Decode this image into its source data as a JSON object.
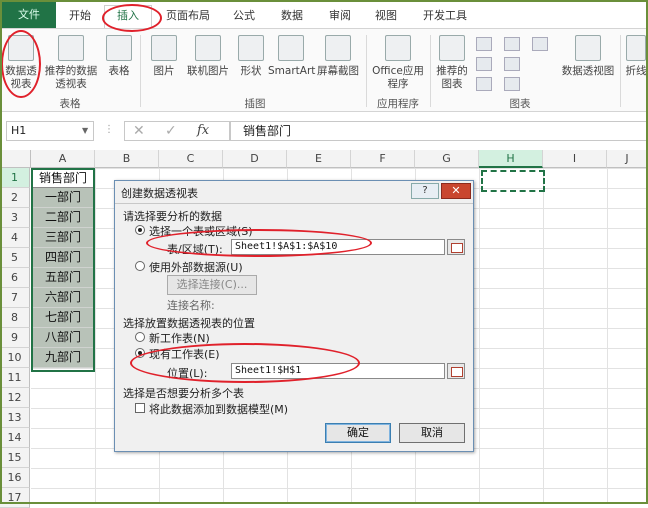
{
  "ribbon_tabs": {
    "file": "文件",
    "home": "开始",
    "insert": "插入",
    "page_layout": "页面布局",
    "formulas": "公式",
    "data": "数据",
    "review": "审阅",
    "view": "视图",
    "developer": "开发工具"
  },
  "ribbon": {
    "pivot_table": "数据透视表",
    "recommended_pivot": "推荐的数据透视表",
    "table": "表格",
    "group_tables": "表格",
    "pictures": "图片",
    "online_pictures": "联机图片",
    "shapes": "形状",
    "smartart": "SmartArt",
    "screenshot": "屏幕截图",
    "group_illustrations": "插图",
    "office_apps": "Office应用程序",
    "group_apps": "应用程序",
    "recommended_charts": "推荐的图表",
    "pivot_chart": "数据透视图",
    "group_charts": "图表",
    "sparkline": "折线"
  },
  "formula_bar": {
    "name_box": "H1",
    "cancel": "✕",
    "enter": "✓",
    "fx": "fx",
    "content": "销售部门"
  },
  "columns": [
    "A",
    "B",
    "C",
    "D",
    "E",
    "F",
    "G",
    "H",
    "I",
    "J"
  ],
  "rows": [
    "1",
    "2",
    "3",
    "4",
    "5",
    "6",
    "7",
    "8",
    "9",
    "10",
    "11",
    "12",
    "13",
    "14",
    "15",
    "16",
    "17"
  ],
  "cells": {
    "a": [
      "销售部门",
      "一部门",
      "二部门",
      "三部门",
      "四部门",
      "五部门",
      "六部门",
      "七部门",
      "八部门",
      "九部门"
    ]
  },
  "dialog": {
    "title": "创建数据透视表",
    "help": "?",
    "close": "✕",
    "section1": "请选择要分析的数据",
    "opt_select_range": "选择一个表或区域(S)",
    "range_label": "表/区域(T):",
    "range_value": "Sheet1!$A$1:$A$10",
    "opt_external": "使用外部数据源(U)",
    "choose_connection": "选择连接(C)...",
    "connection_name": "连接名称:",
    "section2": "选择放置数据透视表的位置",
    "opt_new_sheet": "新工作表(N)",
    "opt_existing_sheet": "现有工作表(E)",
    "location_label": "位置(L):",
    "location_value": "Sheet1!$H$1",
    "section3": "选择是否想要分析多个表",
    "add_to_model": "将此数据添加到数据模型(M)",
    "ok": "确定",
    "cancel": "取消"
  }
}
